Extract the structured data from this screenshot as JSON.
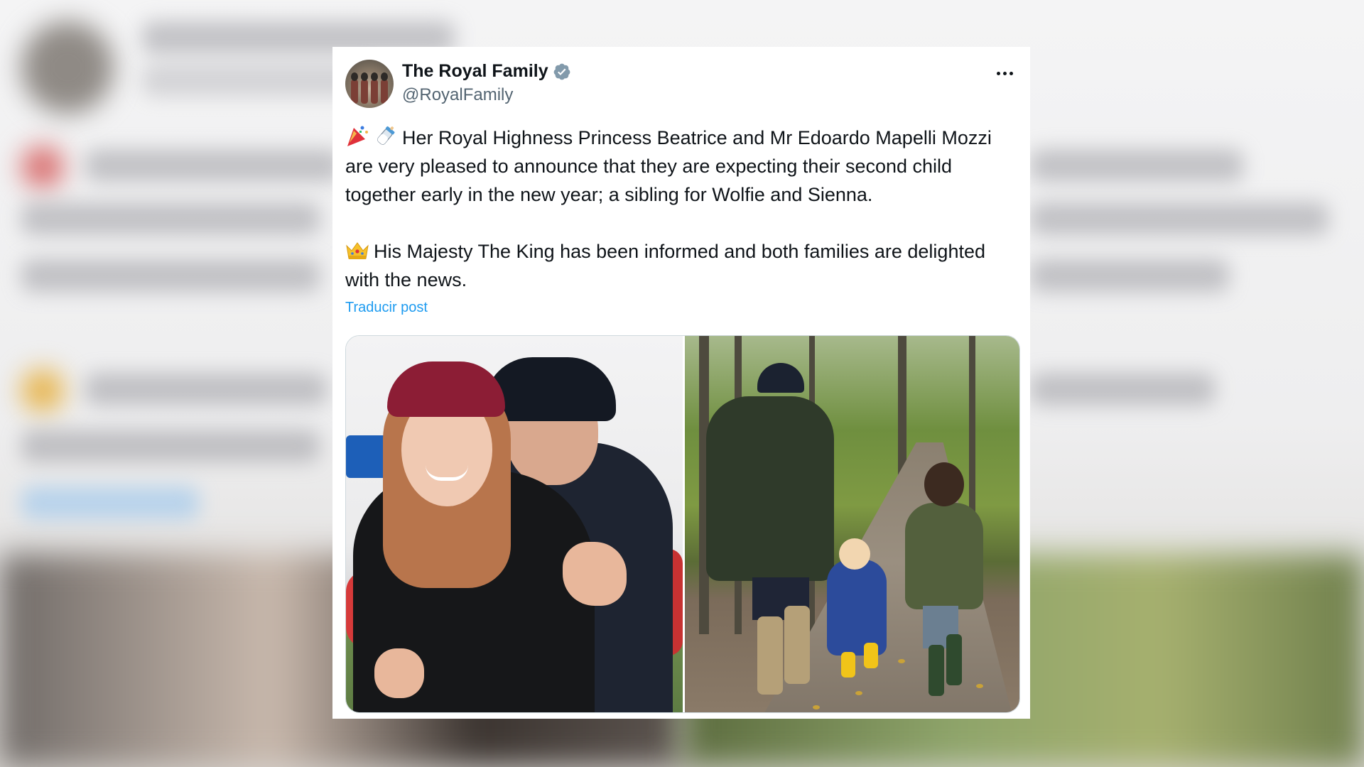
{
  "tweet": {
    "display_name": "The Royal Family",
    "handle": "@RoyalFamily",
    "verified": true,
    "avatar_icon": "royal-family-avatar",
    "more_icon": "more-options-icon",
    "paragraph1_emoji": [
      "party-popper-icon",
      "baby-bottle-icon"
    ],
    "paragraph1": "Her Royal Highness Princess Beatrice and Mr Edoardo Mapelli Mozzi are very pleased to announce that they are expecting their second child together early in the new year; a sibling for Wolfie and Sienna.",
    "paragraph2_emoji": "crown-icon",
    "paragraph2": "His Majesty The King has been informed and both families are delighted with the news.",
    "translate_label": "Traducir post",
    "media": [
      {
        "name": "photo-couple-hug"
      },
      {
        "name": "photo-family-walk"
      }
    ]
  },
  "colors": {
    "link": "#1d9bf0",
    "verified_badge": "#829aab",
    "text_primary": "#0f1419",
    "text_secondary": "#536471"
  }
}
